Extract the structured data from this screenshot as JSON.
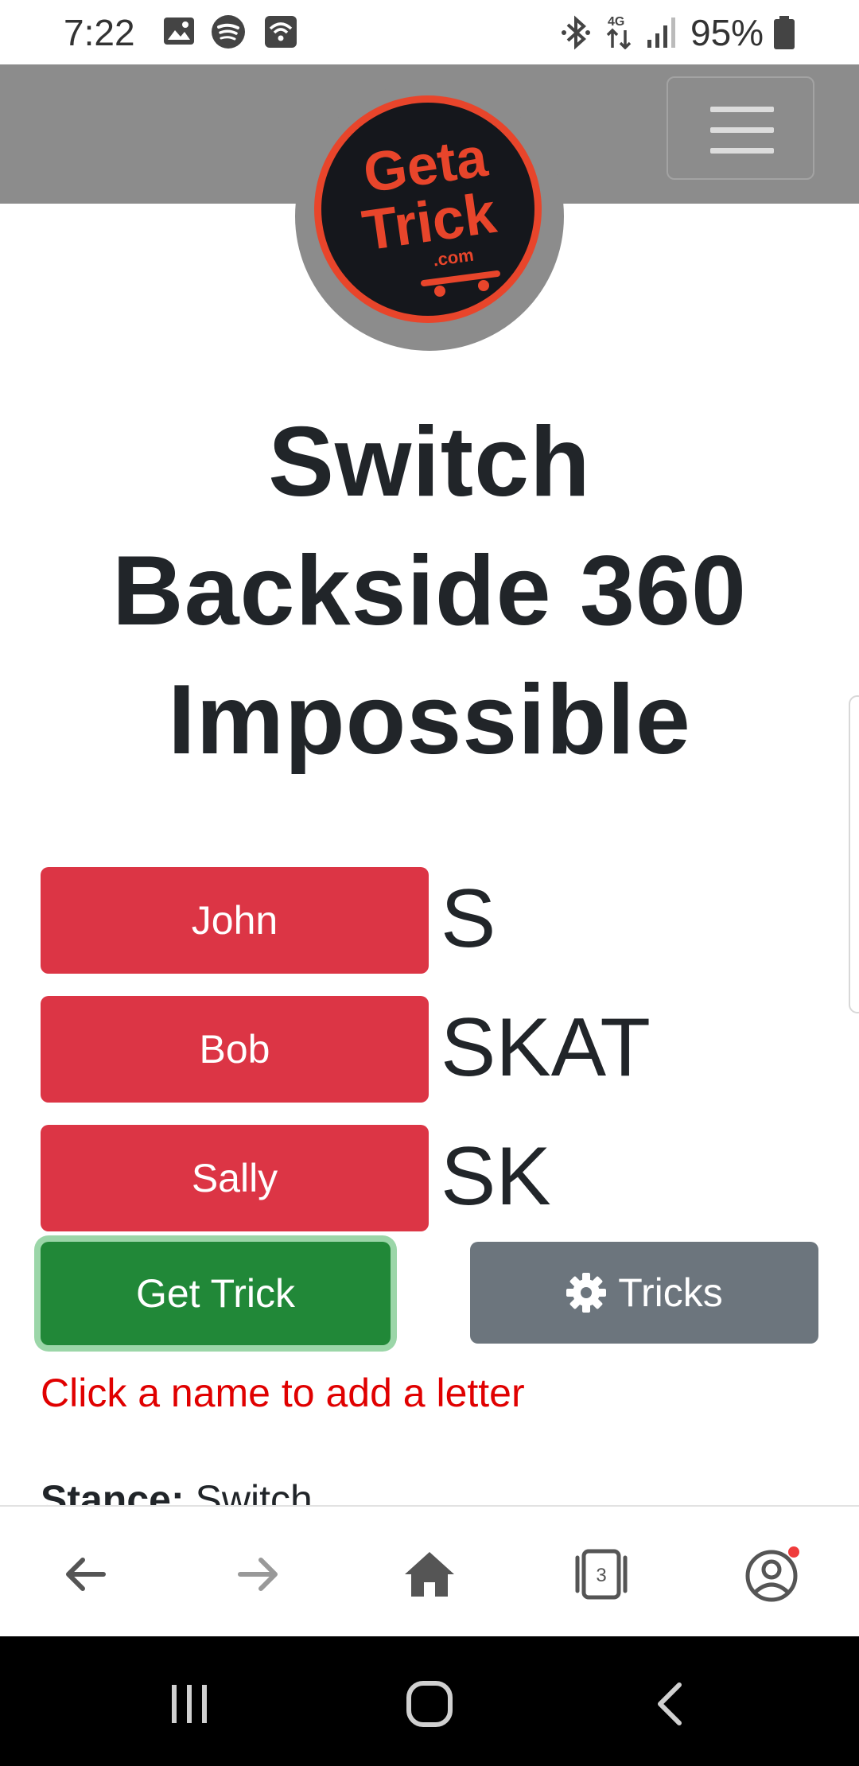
{
  "status_bar": {
    "time": "7:22",
    "network": "4G",
    "battery": "95%",
    "icons": [
      "gallery-icon",
      "spotify-icon",
      "wifi-calling-icon",
      "bluetooth-icon",
      "data-arrows-icon",
      "signal-icon",
      "battery-icon"
    ]
  },
  "header": {
    "logo_text": "Geta Trick .com",
    "menu_icon": "hamburger-menu-icon"
  },
  "trick": {
    "title": "Switch Backside 360 Impossible"
  },
  "players": [
    {
      "name": "John",
      "letters": "S"
    },
    {
      "name": "Bob",
      "letters": "SKAT"
    },
    {
      "name": "Sally",
      "letters": "SK"
    }
  ],
  "actions": {
    "get_trick": "Get Trick",
    "tricks": "Tricks",
    "tricks_icon": "gear-icon"
  },
  "hint": "Click a name to add a letter",
  "details": {
    "stance_label": "Stance:",
    "stance_value": "Switch"
  },
  "browser_bar": {
    "tabs_count": "3",
    "buttons": [
      "back-arrow-icon",
      "forward-arrow-icon",
      "home-icon",
      "tabs-icon",
      "profile-icon"
    ]
  },
  "colors": {
    "navbar": "#8c8c8c",
    "player_button": "#dc3545",
    "get_trick_button": "#218838",
    "tricks_button": "#6c757d",
    "hint_text": "#e00000"
  }
}
